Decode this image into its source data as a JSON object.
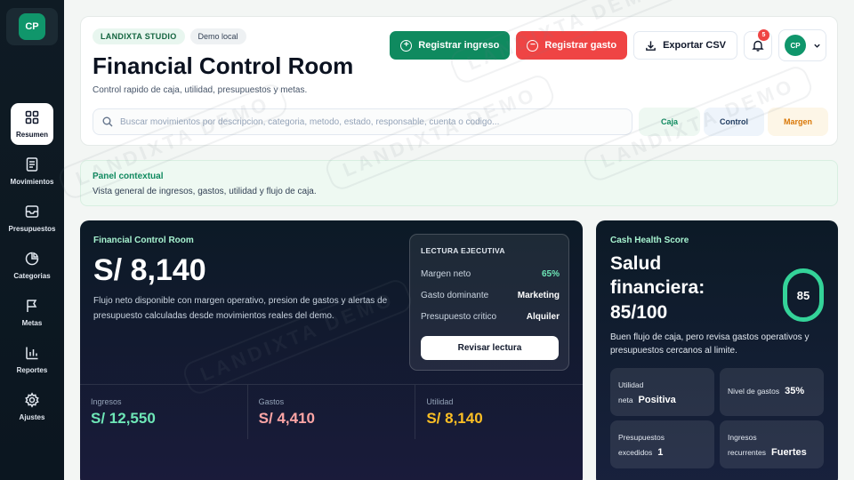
{
  "sidebar": {
    "logo": "CP",
    "items": [
      {
        "label": "Resumen",
        "icon": "grid-icon",
        "active": true
      },
      {
        "label": "Movimientos",
        "icon": "document-icon"
      },
      {
        "label": "Presupuestos",
        "icon": "inbox-icon"
      },
      {
        "label": "Categorias",
        "icon": "pie-chart-icon"
      },
      {
        "label": "Metas",
        "icon": "flag-icon"
      },
      {
        "label": "Reportes",
        "icon": "bar-chart-icon"
      },
      {
        "label": "Ajustes",
        "icon": "gear-icon"
      }
    ]
  },
  "header": {
    "chip_studio": "LANDIXTA STUDIO",
    "chip_demo": "Demo local",
    "title": "Financial Control Room",
    "subtitle": "Control rapido de caja, utilidad, presupuestos y metas.",
    "actions": {
      "income": "Registrar ingreso",
      "expense": "Registrar gasto",
      "export": "Exportar CSV"
    },
    "notifications": "5",
    "avatar": "CP",
    "search_placeholder": "Buscar movimientos por descripcion, categoria, metodo, estado, responsable, cuenta o codigo...",
    "quick": {
      "caja": "Caja",
      "control": "Control",
      "margen": "Margen"
    }
  },
  "context": {
    "heading": "Panel contextual",
    "description": "Vista general de ingresos, gastos, utilidad y flujo de caja."
  },
  "hero": {
    "eyebrow": "Financial Control Room",
    "amount": "S/ 8,140",
    "description": "Flujo neto disponible con margen operativo, presion de gastos y alertas de presupuesto calculadas desde movimientos reales del demo.",
    "lectura": {
      "heading": "LECTURA EJECUTIVA",
      "rows": [
        {
          "k": "Margen neto",
          "v": "65%"
        },
        {
          "k": "Gasto dominante",
          "v": "Marketing"
        },
        {
          "k": "Presupuesto critico",
          "v": "Alquiler"
        }
      ],
      "button": "Revisar lectura"
    },
    "stats": [
      {
        "label": "Ingresos",
        "value": "S/ 12,550",
        "color": "#6ee7b7"
      },
      {
        "label": "Gastos",
        "value": "S/ 4,410",
        "color": "#fca5a5"
      },
      {
        "label": "Utilidad",
        "value": "S/ 8,140",
        "color": "#fbbf24"
      }
    ]
  },
  "health": {
    "eyebrow": "Cash Health Score",
    "title": "Salud financiera: 85/100",
    "score": "85",
    "description": "Buen flujo de caja, pero revisa gastos operativos y presupuestos cercanos al limite.",
    "cards": [
      {
        "k1": "Utilidad",
        "k2": "neta",
        "v": "Positiva"
      },
      {
        "k1": "",
        "k2": "Nivel de gastos",
        "v": "35%"
      },
      {
        "k1": "Presupuestos",
        "k2": "excedidos",
        "v": "1"
      },
      {
        "k1": "Ingresos",
        "k2": "recurrentes",
        "v": "Fuertes"
      }
    ]
  },
  "watermark": "LANDIXTA DEMO",
  "colors": {
    "accent_green": "#0f8a5f",
    "danger_red": "#ef4444"
  }
}
